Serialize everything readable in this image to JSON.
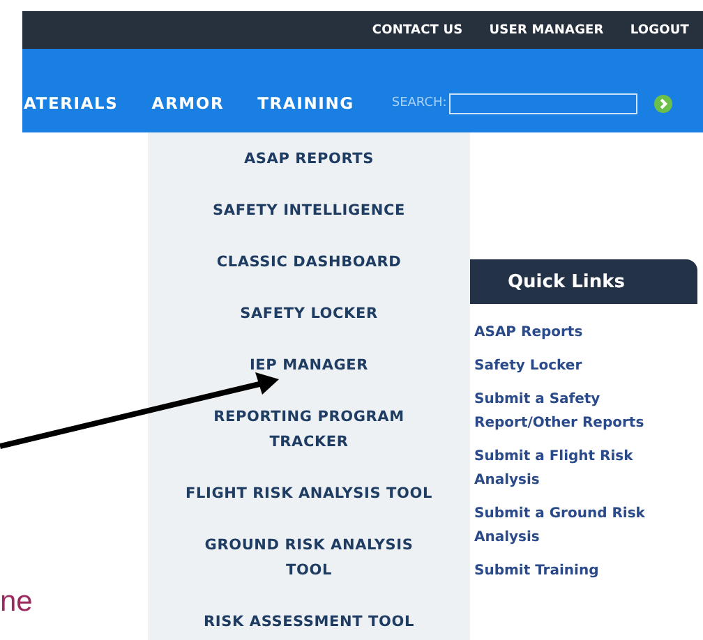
{
  "top_links": [
    "CONTACT US",
    "USER MANAGER",
    "LOGOUT"
  ],
  "nav": {
    "items": [
      "ATERIALS",
      "ARMOR",
      "TRAINING"
    ],
    "search_label": "SEARCH:"
  },
  "dropdown": {
    "items": [
      [
        "ASAP REPORTS"
      ],
      [
        "SAFETY INTELLIGENCE"
      ],
      [
        "CLASSIC DASHBOARD"
      ],
      [
        "SAFETY LOCKER"
      ],
      [
        "IEP MANAGER"
      ],
      [
        "REPORTING PROGRAM",
        "TRACKER"
      ],
      [
        "FLIGHT RISK ANALYSIS TOOL"
      ],
      [
        "GROUND RISK ANALYSIS",
        "TOOL"
      ],
      [
        "RISK ASSESSMENT TOOL"
      ]
    ]
  },
  "quick_links": {
    "title": "Quick Links",
    "links": [
      [
        "ASAP Reports"
      ],
      [
        "Safety Locker"
      ],
      [
        "Submit a Safety",
        "Report/Other Reports"
      ],
      [
        "Submit a Flight Risk",
        "Analysis"
      ],
      [
        "Submit a Ground Risk",
        "Analysis"
      ],
      [
        "Submit Training"
      ]
    ]
  },
  "slide_text": [
    "ne"
  ]
}
